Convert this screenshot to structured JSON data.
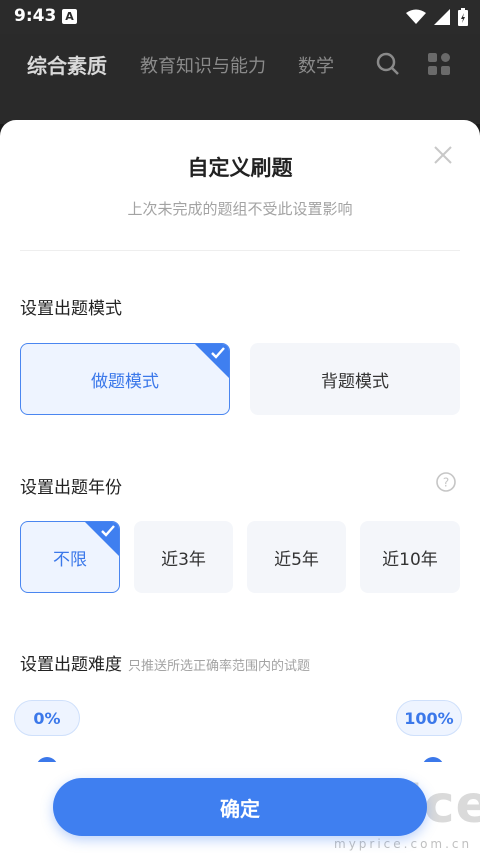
{
  "status_bar": {
    "time": "9:43",
    "notification_icon": "A"
  },
  "background_tabs": [
    "综合素质",
    "教育知识与能力",
    "数学"
  ],
  "sheet": {
    "title": "自定义刷题",
    "subtitle": "上次未完成的题组不受此设置影响",
    "mode_section": {
      "title": "设置出题模式",
      "options": [
        "做题模式",
        "背题模式"
      ],
      "selected": "做题模式"
    },
    "year_section": {
      "title": "设置出题年份",
      "options": [
        "不限",
        "近3年",
        "近5年",
        "近10年"
      ],
      "selected": "不限"
    },
    "difficulty_section": {
      "title": "设置出题难度",
      "hint": "只推送所选正确率范围内的试题",
      "min_label": "0%",
      "max_label": "100%",
      "range": [
        0,
        100
      ]
    },
    "confirm_label": "确定"
  },
  "watermark": {
    "big": "price",
    "small": "myprice.com.cn"
  },
  "colors": {
    "accent": "#3f7ff0",
    "selected_bg": "#eef4ff",
    "option_bg": "#f4f6fa"
  }
}
